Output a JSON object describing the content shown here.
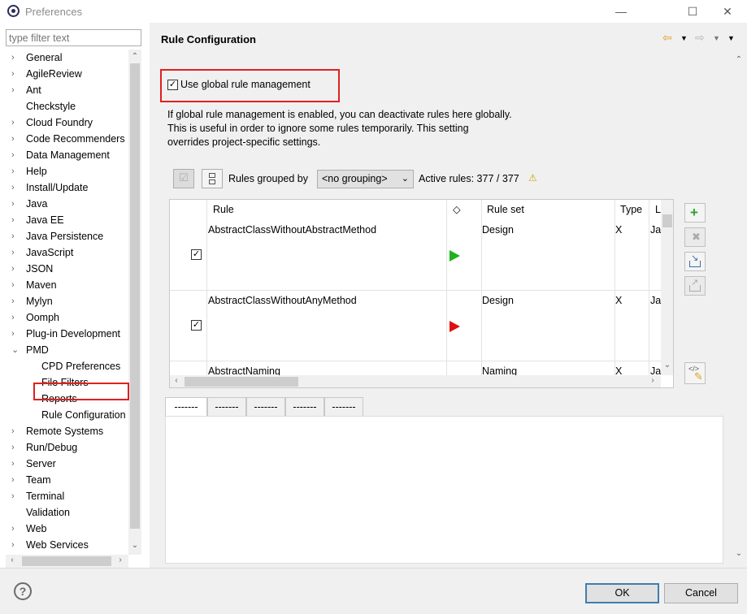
{
  "window": {
    "title": "Preferences",
    "minimize": "—",
    "maximize": "☐",
    "close": "✕"
  },
  "filter": {
    "placeholder": "type filter text"
  },
  "tree": [
    {
      "label": "General",
      "expander": "›"
    },
    {
      "label": "AgileReview",
      "expander": "›"
    },
    {
      "label": "Ant",
      "expander": "›"
    },
    {
      "label": "Checkstyle",
      "expander": ""
    },
    {
      "label": "Cloud Foundry",
      "expander": "›"
    },
    {
      "label": "Code Recommenders",
      "expander": "›"
    },
    {
      "label": "Data Management",
      "expander": "›"
    },
    {
      "label": "Help",
      "expander": "›"
    },
    {
      "label": "Install/Update",
      "expander": "›"
    },
    {
      "label": "Java",
      "expander": "›"
    },
    {
      "label": "Java EE",
      "expander": "›"
    },
    {
      "label": "Java Persistence",
      "expander": "›"
    },
    {
      "label": "JavaScript",
      "expander": "›"
    },
    {
      "label": "JSON",
      "expander": "›"
    },
    {
      "label": "Maven",
      "expander": "›"
    },
    {
      "label": "Mylyn",
      "expander": "›"
    },
    {
      "label": "Oomph",
      "expander": "›"
    },
    {
      "label": "Plug-in Development",
      "expander": "›"
    },
    {
      "label": "PMD",
      "expander": "⌄"
    },
    {
      "label": "CPD Preferences",
      "child": true
    },
    {
      "label": "File Filters",
      "child": true
    },
    {
      "label": "Reports",
      "child": true
    },
    {
      "label": "Rule Configuration",
      "child": true,
      "selected": true
    },
    {
      "label": "Remote Systems",
      "expander": "›"
    },
    {
      "label": "Run/Debug",
      "expander": "›"
    },
    {
      "label": "Server",
      "expander": "›"
    },
    {
      "label": "Team",
      "expander": "›"
    },
    {
      "label": "Terminal",
      "expander": "›"
    },
    {
      "label": "Validation",
      "expander": ""
    },
    {
      "label": "Web",
      "expander": "›"
    },
    {
      "label": "Web Services",
      "expander": "›"
    }
  ],
  "page": {
    "title": "Rule Configuration",
    "global_rule_label": "Use global rule management",
    "global_rule_checked": true,
    "description_lines": [
      "If global rule management is enabled, you can deactivate rules here globally.",
      "This is useful in order to ignore some rules temporarily. This setting",
      "overrides project-specific settings."
    ],
    "grouped_by_label": "Rules grouped by",
    "grouping_value": "<no grouping>",
    "active_rules": "Active rules: 377 / 377",
    "warning_icon": "warning-icon"
  },
  "table": {
    "headers": {
      "rule": "Rule",
      "priority_icon": "◇",
      "ruleset": "Rule set",
      "type": "Type",
      "lang": "L"
    },
    "rows": [
      {
        "checked": true,
        "rule": "AbstractClassWithoutAbstractMethod",
        "ruleset": "Design",
        "type": "X",
        "lang": "Ja",
        "flag_color": "#1db31d"
      },
      {
        "checked": true,
        "rule": "AbstractClassWithoutAnyMethod",
        "ruleset": "Design",
        "type": "X",
        "lang": "Ja",
        "flag_color": "#e01010"
      },
      {
        "checked": false,
        "rule": "AbstractNaming",
        "ruleset": "Naming",
        "type": "X",
        "lang": "Ja",
        "flag_color": ""
      }
    ]
  },
  "tabs": [
    "-------",
    "-------",
    "-------",
    "-------",
    "-------"
  ],
  "buttons": {
    "ok": "OK",
    "cancel": "Cancel",
    "help": "?"
  },
  "colors": {
    "highlight": "#e02020",
    "ok_border": "#3c7fb1"
  }
}
